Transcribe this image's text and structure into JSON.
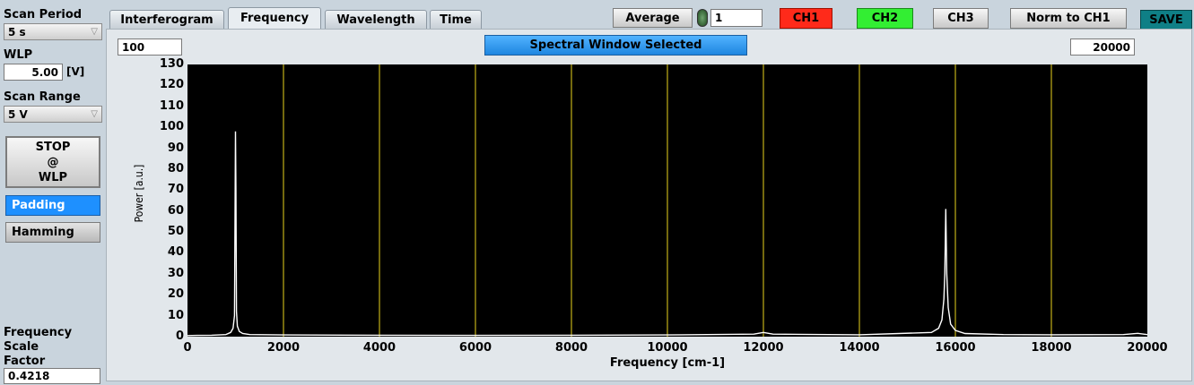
{
  "left_panel": {
    "scan_period_label": "Scan Period",
    "scan_period_value": "5 s",
    "wlp_label": "WLP",
    "wlp_value": "5.00",
    "wlp_unit": "[V]",
    "scan_range_label": "Scan Range",
    "scan_range_value": "5 V",
    "stop_button_line1": "STOP",
    "stop_button_line2": "@",
    "stop_button_line3": "WLP",
    "padding_label": "Padding",
    "hamming_label": "Hamming",
    "freq_scale_line1": "Frequency",
    "freq_scale_line2": "Scale",
    "freq_scale_line3": "Factor",
    "freq_scale_value": "0.4218"
  },
  "tabs": [
    {
      "label": "Interferogram",
      "active": false
    },
    {
      "label": "Frequency",
      "active": true
    },
    {
      "label": "Wavelength",
      "active": false
    },
    {
      "label": "Time",
      "active": false
    }
  ],
  "toolbar": {
    "average_label": "Average",
    "average_value": "1",
    "ch1_label": "CH1",
    "ch2_label": "CH2",
    "ch3_label": "CH3",
    "norm_label": "Norm to CH1",
    "save_label": "SAVE"
  },
  "colors": {
    "ch1": "#ff2a1a",
    "ch2": "#33ee33",
    "ch3": "#d9d9d9",
    "save": "#0f7f86",
    "padding_active": "#1e90ff",
    "spectral_banner": "#2f9ff0",
    "plot_bg": "#000000",
    "grid": "#e8d21c",
    "trace": "#ffffff"
  },
  "plot": {
    "range_min_value": "100",
    "range_max_value": "20000",
    "spectral_banner": "Spectral Window Selected"
  },
  "chart_data": {
    "type": "line",
    "title": "",
    "xlabel": "Frequency [cm-1]",
    "ylabel": "Power [a.u.]",
    "xlim": [
      0,
      20000
    ],
    "ylim": [
      0,
      130
    ],
    "x_ticks": [
      "0",
      "2000",
      "4000",
      "6000",
      "8000",
      "10000",
      "12000",
      "14000",
      "16000",
      "18000",
      "20000"
    ],
    "y_ticks": [
      "0",
      "10",
      "20",
      "30",
      "40",
      "50",
      "60",
      "70",
      "80",
      "90",
      "100",
      "110",
      "120",
      "130"
    ],
    "x_grid": [
      2000,
      4000,
      6000,
      8000,
      10000,
      12000,
      14000,
      16000,
      18000
    ],
    "series": [
      {
        "x": [
          0,
          200,
          500,
          800,
          900,
          950,
          980,
          1000,
          1010,
          1020,
          1040,
          1080,
          1150,
          1300,
          2000,
          4000,
          6000,
          8000,
          10000,
          11800,
          12000,
          12200,
          14000,
          15500,
          15650,
          15720,
          15760,
          15780,
          15800,
          15820,
          15850,
          15900,
          16000,
          16200,
          17000,
          18000,
          19500,
          19800,
          20000
        ],
        "y": [
          0.5,
          0.6,
          0.7,
          1.0,
          2.0,
          4.0,
          10.0,
          98.0,
          70.0,
          12.0,
          5.0,
          2.5,
          1.5,
          1.0,
          0.8,
          0.7,
          0.6,
          0.7,
          0.8,
          1.2,
          2.0,
          1.2,
          0.9,
          2.0,
          4.0,
          8.0,
          18.0,
          30.0,
          61.0,
          30.0,
          14.0,
          6.0,
          3.0,
          1.5,
          1.0,
          0.9,
          1.0,
          1.6,
          1.0
        ]
      }
    ]
  }
}
